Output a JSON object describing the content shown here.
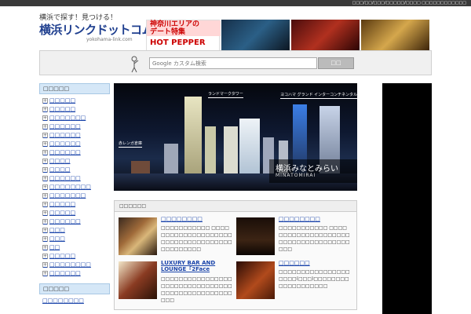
{
  "topbar": {
    "text": "□□□/□□/□□□/□□□□□/□□□□ □□□□□□□□□□□□"
  },
  "logo": {
    "tagline": "横浜で探す！見つける！",
    "name": "横浜リンクドットコム",
    "url": "yokohama-link.com"
  },
  "ad": {
    "line1": "神奈川エリアの",
    "line2": "デート特集",
    "brand": "HOT PEPPER"
  },
  "search": {
    "placeholder": "Google カスタム検索",
    "button": "□□"
  },
  "sidebar": {
    "heading": "□□□□□",
    "items": [
      {
        "label": "□□□□□"
      },
      {
        "label": "□□□□□"
      },
      {
        "label": "□□□□□□□"
      },
      {
        "label": "□□□□□□"
      },
      {
        "label": "□□□□□□"
      },
      {
        "label": "□□□□□□"
      },
      {
        "label": "□□□□□□"
      },
      {
        "label": "□□□□"
      },
      {
        "label": "□□□□"
      },
      {
        "label": "□□□□□□"
      },
      {
        "label": "□□□□□□□□"
      },
      {
        "label": "□□□□□□□"
      },
      {
        "label": "□□□□□"
      },
      {
        "label": "□□□□□"
      },
      {
        "label": "□□□□□□"
      },
      {
        "label": "□□□"
      },
      {
        "label": "□□□"
      },
      {
        "label": "□□"
      },
      {
        "label": "□□□□□"
      },
      {
        "label": "□□□□□□□□"
      },
      {
        "label": "□□□□□□"
      }
    ],
    "heading2": "□□□□□",
    "items2": [
      {
        "label": "□□□□□□□□"
      }
    ]
  },
  "hero": {
    "label_landmark": "ランドマークタワー",
    "label_hotel": "ヨコハマ グランド インターコンチネンタル ホテル",
    "label_left": "赤レンガ倉庫",
    "title": "横浜みなとみらい",
    "subtitle": "MINATOMIRAI"
  },
  "feature": {
    "heading": "□□□□□□",
    "cards": [
      {
        "title": "□□□□□□□□",
        "desc": "□□□□□□□□□□□ □□□□□□□□□□□□□□□□□□□□□□□□□□□□□□□□□□□□□□□□□□□□□"
      },
      {
        "title": "□□□□□□□□",
        "desc": "□□□□□□□□□□□ □□□□□□□□□□□□□□□□□□□□□□□□□□□□□□□□□□□□□□□"
      },
      {
        "title": "LUXURY BAR AND LOUNGE「2Face",
        "desc": "□□□□□□□□□□□□□□□□□□□□□□□□□□□□□□□□□□□□□□□□□□□□□□□□□□□"
      },
      {
        "title": "□□□□□□",
        "desc": "□□□□□□□□□□□□□□□□□□□□(□□□)□□□□□□□□□□□□□□□□□□□"
      }
    ]
  },
  "colors": {
    "link": "#1a44aa",
    "logo": "#1f3f8f",
    "sidebar_head": "#d5e7f7",
    "ad_red": "#cc0000"
  }
}
